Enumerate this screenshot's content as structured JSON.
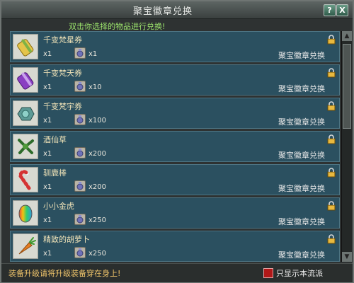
{
  "window": {
    "title": "聚宝徽章兑换",
    "help_label": "?",
    "close_label": "X"
  },
  "instruction": "双击你选择的物品进行兑换!",
  "items": [
    {
      "name": "千变梵星券",
      "qty": "x1",
      "cost": "x1",
      "action": "聚宝徽章兑换",
      "icon": "scroll-yellow-icon"
    },
    {
      "name": "千变梵天券",
      "qty": "x1",
      "cost": "x10",
      "action": "聚宝徽章兑换",
      "icon": "scroll-purple-icon"
    },
    {
      "name": "千变梵宇券",
      "qty": "x1",
      "cost": "x100",
      "action": "聚宝徽章兑换",
      "icon": "ornament-teal-icon"
    },
    {
      "name": "酒仙草",
      "qty": "x1",
      "cost": "x200",
      "action": "聚宝徽章兑换",
      "icon": "herb-icon"
    },
    {
      "name": "驯鹿棒",
      "qty": "x1",
      "cost": "x200",
      "action": "聚宝徽章兑换",
      "icon": "candy-cane-icon"
    },
    {
      "name": "小小金虎",
      "qty": "x1",
      "cost": "x250",
      "action": "聚宝徽章兑换",
      "icon": "rainbow-egg-icon"
    },
    {
      "name": "精致的胡萝卜",
      "qty": "x1",
      "cost": "x250",
      "action": "聚宝徽章兑换",
      "icon": "carrot-icon"
    }
  ],
  "footer": {
    "tip": "装备升级请将升级装备穿在身上!",
    "filter_label": "只显示本流派",
    "filter_checked": true
  }
}
